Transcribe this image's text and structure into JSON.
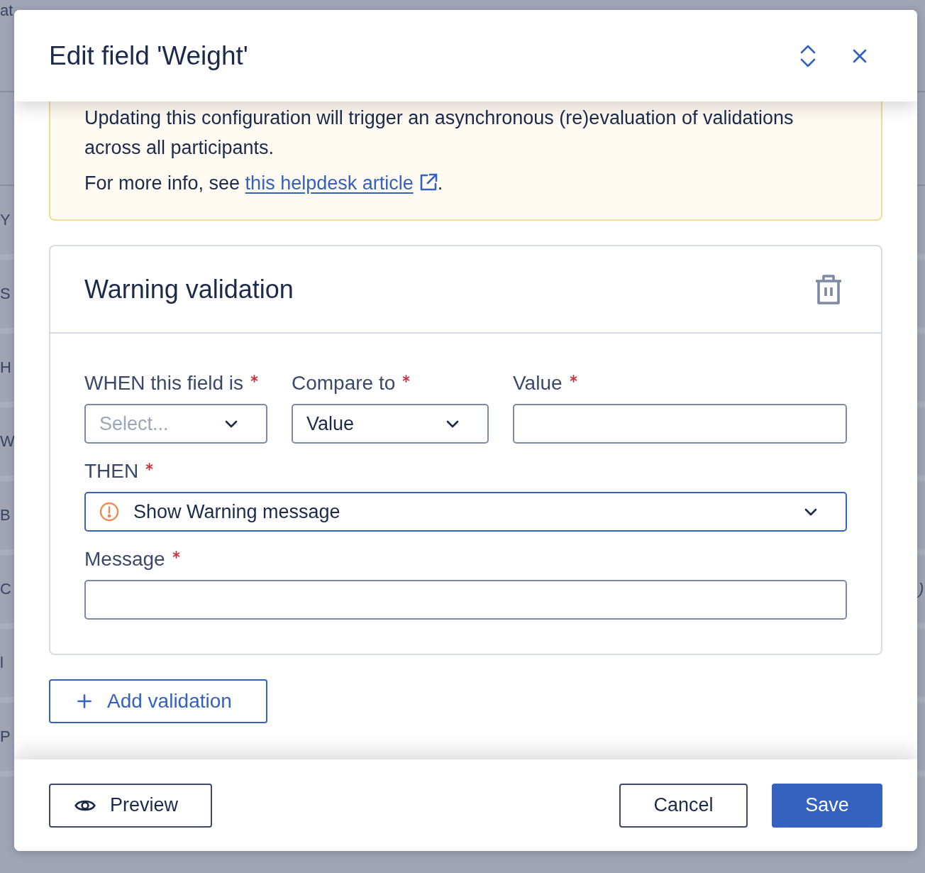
{
  "backdrop": {
    "header_cells": [
      "at"
    ],
    "rows": [
      {
        "column_1": "Y"
      },
      {
        "column_1": "S"
      },
      {
        "column_1": "H"
      },
      {
        "column_1": "W"
      },
      {
        "column_1": "B"
      },
      {
        "column_1": "C",
        "column_2": ")"
      },
      {
        "column_1": "l"
      },
      {
        "column_1": "P"
      }
    ]
  },
  "dialog": {
    "title": "Edit field 'Weight'"
  },
  "notice": {
    "text": "Updating this configuration will trigger an asynchronous (re)evaluation of validations across all participants.",
    "info_before": "For more info, see",
    "link": "this helpdesk article",
    "info_after": "."
  },
  "validations": [
    {
      "title": "Warning validation",
      "condition_fields": [
        {
          "label": "WHEN this field is",
          "required": true,
          "kind": "select",
          "placeholder": "Select...",
          "focused": false
        },
        {
          "label": "Compare to",
          "required": true,
          "kind": "select",
          "value": "Value",
          "focused": false
        },
        {
          "label": "Value",
          "required": true,
          "kind": "input",
          "focused": false
        }
      ],
      "fields": [
        {
          "label": "THEN",
          "required": true,
          "kind": "action-select",
          "value": "Show Warning message",
          "focused": true
        },
        {
          "label": "Message",
          "required": true,
          "kind": "input",
          "focused": false
        }
      ]
    }
  ],
  "add_button": {
    "label": "Add validation"
  },
  "footer": {
    "buttons": [
      {
        "label": "Preview",
        "kind": "preview"
      },
      {
        "label": "Cancel",
        "kind": "secondary"
      },
      {
        "label": "Save",
        "kind": "primary"
      }
    ]
  }
}
